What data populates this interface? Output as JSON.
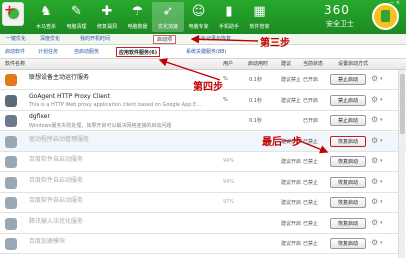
{
  "colors": {
    "topbar_green": "#1f9a26",
    "link_blue": "#2a56a6",
    "annotation_red": "#c20000"
  },
  "window": {
    "brand_number": "360",
    "brand_name": "安全卫士",
    "controls": "— ×"
  },
  "top_tabs": [
    {
      "label": "木马查杀",
      "icon": "trojan-scan-icon",
      "glyph": "♞"
    },
    {
      "label": "电脑清理",
      "icon": "broom-icon",
      "glyph": "✎"
    },
    {
      "label": "修复漏洞",
      "icon": "repair-icon",
      "glyph": "✚"
    },
    {
      "label": "电脑救援",
      "icon": "rescue-icon",
      "glyph": "☂"
    },
    {
      "label": "优化加速",
      "icon": "rocket-icon",
      "glyph": "➶",
      "active": true
    },
    {
      "label": "电脑专家",
      "icon": "expert-icon",
      "glyph": "☺"
    },
    {
      "label": "手机助手",
      "icon": "phone-icon",
      "glyph": "▮"
    },
    {
      "label": "软件管家",
      "icon": "software-icon",
      "glyph": "▦"
    }
  ],
  "sub_tabs": {
    "t1": "一键优化",
    "t2": "深度优化",
    "t3": "我的开机时间",
    "t4": "启动项",
    "t5": "优化记录与恢复"
  },
  "categories": {
    "c1": "启动软件",
    "c2": "计划任务",
    "c3": "自启动服务",
    "c4": "应用软件服务(6)",
    "c5": "系统关键服务(88)"
  },
  "table_header": {
    "name": "软件名称",
    "pct": "用户",
    "time": "启动用时",
    "sug": "建议",
    "stat": "当前状态",
    "action": "设置启动方式"
  },
  "rows": [
    {
      "name": "联想设备主动运行服务",
      "desc": "",
      "pct": "%",
      "time": "0.1秒",
      "sug": "建议禁止",
      "stat": "已开启",
      "btn": "禁止启动",
      "icon_color": "#e07a1a"
    },
    {
      "name": "GoAgent HTTP Proxy Client",
      "desc": "This is a HTTP Web proxy application client based on Google App E...",
      "pct": "%",
      "time": "0.1秒",
      "sug": "建议禁止",
      "stat": "已开启",
      "btn": "禁止启动",
      "icon_color": "#5a6b7a"
    },
    {
      "name": "dgfixer",
      "desc": "Windows服务失败处理，如果开启可以解决网络连接的启动问题",
      "pct": "",
      "time": "0.1秒",
      "sug": "",
      "stat": "已开启",
      "btn": "禁止启动",
      "icon_color": "#6a7a8a"
    },
    {
      "name": "驱动程序启动管理服务",
      "desc": "",
      "pct": "",
      "time": "",
      "sug": "建议开启",
      "stat": "已禁止",
      "btn": "恢复启动",
      "icon_color": "#9aa8b6",
      "faded": true,
      "highlight": true
    },
    {
      "name": "百度软件自启动服务",
      "desc": "",
      "pct": "94%",
      "time": "",
      "sug": "建议开启",
      "stat": "已禁止",
      "btn": "恢复启动",
      "icon_color": "#9aa8b6",
      "faded": true
    },
    {
      "name": "百度软件自启动服务",
      "desc": "",
      "pct": "94%",
      "time": "",
      "sug": "建议开启",
      "stat": "已禁止",
      "btn": "恢复启动",
      "icon_color": "#9aa8b6",
      "faded": true
    },
    {
      "name": "百度软件自启动服务",
      "desc": "",
      "pct": "97%",
      "time": "",
      "sug": "建议开启",
      "stat": "已禁止",
      "btn": "恢复启动",
      "icon_color": "#9aa8b6",
      "faded": true
    },
    {
      "name": "腾讯输入法优化服务",
      "desc": "",
      "pct": "",
      "time": "",
      "sug": "建议开启",
      "stat": "已禁止",
      "btn": "恢复启动",
      "icon_color": "#9aa8b6",
      "faded": true
    },
    {
      "name": "百度加速模块",
      "desc": "",
      "pct": "",
      "time": "",
      "sug": "建议开启",
      "stat": "已禁止",
      "btn": "恢复启动",
      "icon_color": "#9aa8b6",
      "faded": true
    }
  ],
  "annotations": {
    "step3": "第三步",
    "step4": "第四步",
    "last": "最后一步"
  }
}
